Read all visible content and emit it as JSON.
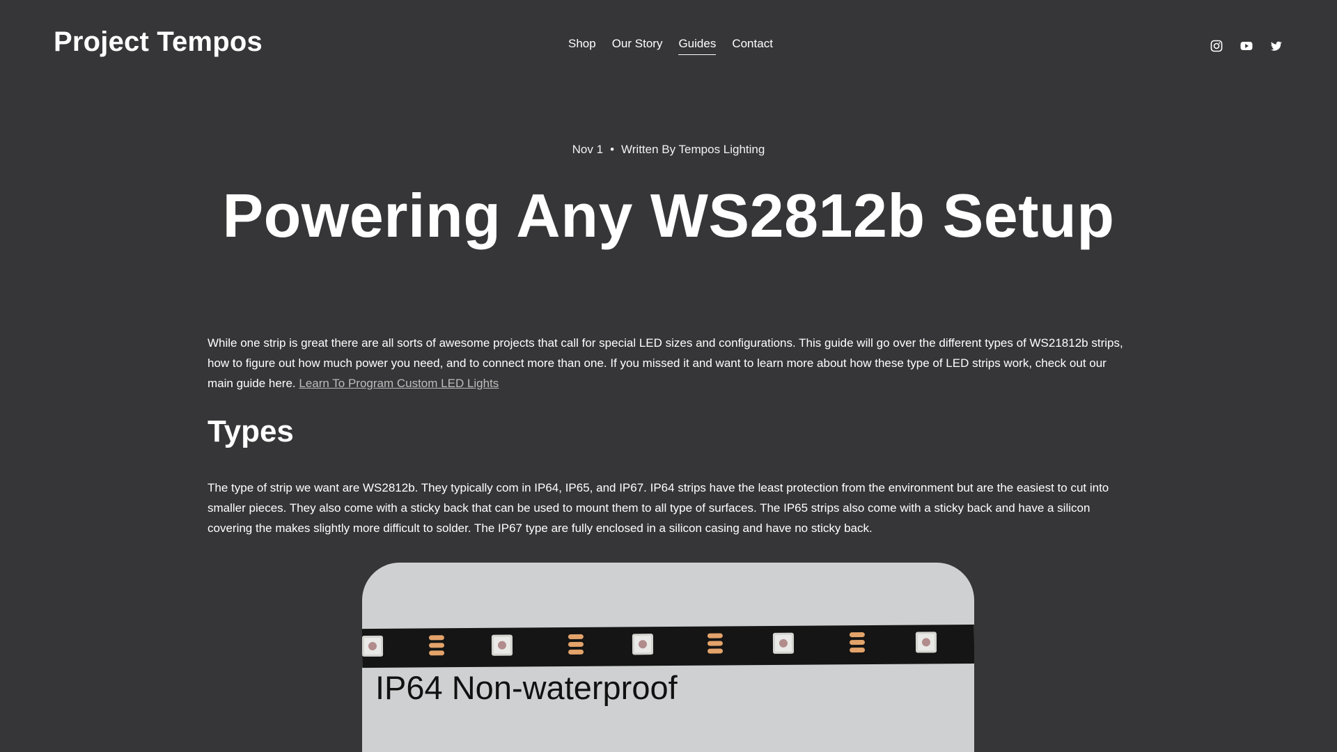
{
  "header": {
    "site_title": "Project Tempos",
    "nav": [
      "Shop",
      "Our Story",
      "Guides",
      "Contact"
    ],
    "active_nav": "Guides",
    "social": [
      "instagram-icon",
      "youtube-icon",
      "twitter-icon"
    ]
  },
  "article": {
    "date": "Nov 1",
    "author": "Written By Tempos Lighting",
    "title": "Powering Any WS2812b Setup",
    "intro": "While one strip is great there are all sorts of awesome projects that call for special LED sizes and configurations. This guide will go over the different types of WS21812b strips, how to figure out how much power you need, and to connect more than one. If you missed it and want to learn more about how these type of LED strips work, check out our main guide here. ",
    "intro_link": "Learn To Program Custom LED Lights",
    "section_heading": "Types",
    "section_body": "The type of strip we want are WS2812b. They typically com in IP64, IP65, and IP67. IP64 strips have the least protection from the environment but are the easiest to cut into smaller pieces. They also come with a sticky back that can be used to mount them to all type of surfaces. The IP65 strips also come with a sticky back and have a silicon covering the makes slightly more difficult to solder. The IP67 type are fully enclosed in a silicon casing and have no sticky back.",
    "image_caption": "IP64 Non-waterproof"
  },
  "colors": {
    "background": "#363638",
    "text": "#ffffff",
    "link": "#bdbdbd"
  }
}
